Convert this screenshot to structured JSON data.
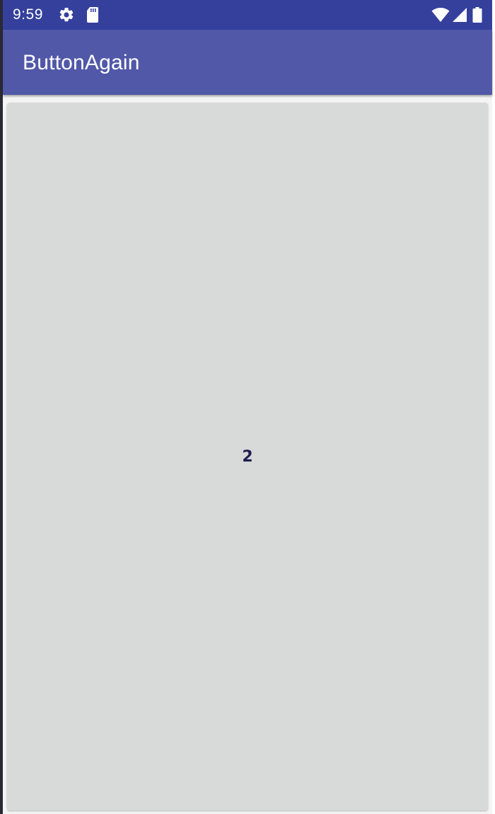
{
  "status_bar": {
    "time": "9:59",
    "icons": [
      "settings-gear-icon",
      "sd-card-icon",
      "wifi-icon",
      "cell-signal-icon",
      "battery-icon"
    ]
  },
  "app_bar": {
    "title": "ButtonAgain"
  },
  "main": {
    "button_label": "2"
  },
  "colors": {
    "status_bar_bg": "#34409c",
    "app_bar_bg": "#5158a8",
    "button_bg": "#d8d9d9",
    "button_text": "#1f1e4e",
    "status_text": "#ffffff"
  }
}
